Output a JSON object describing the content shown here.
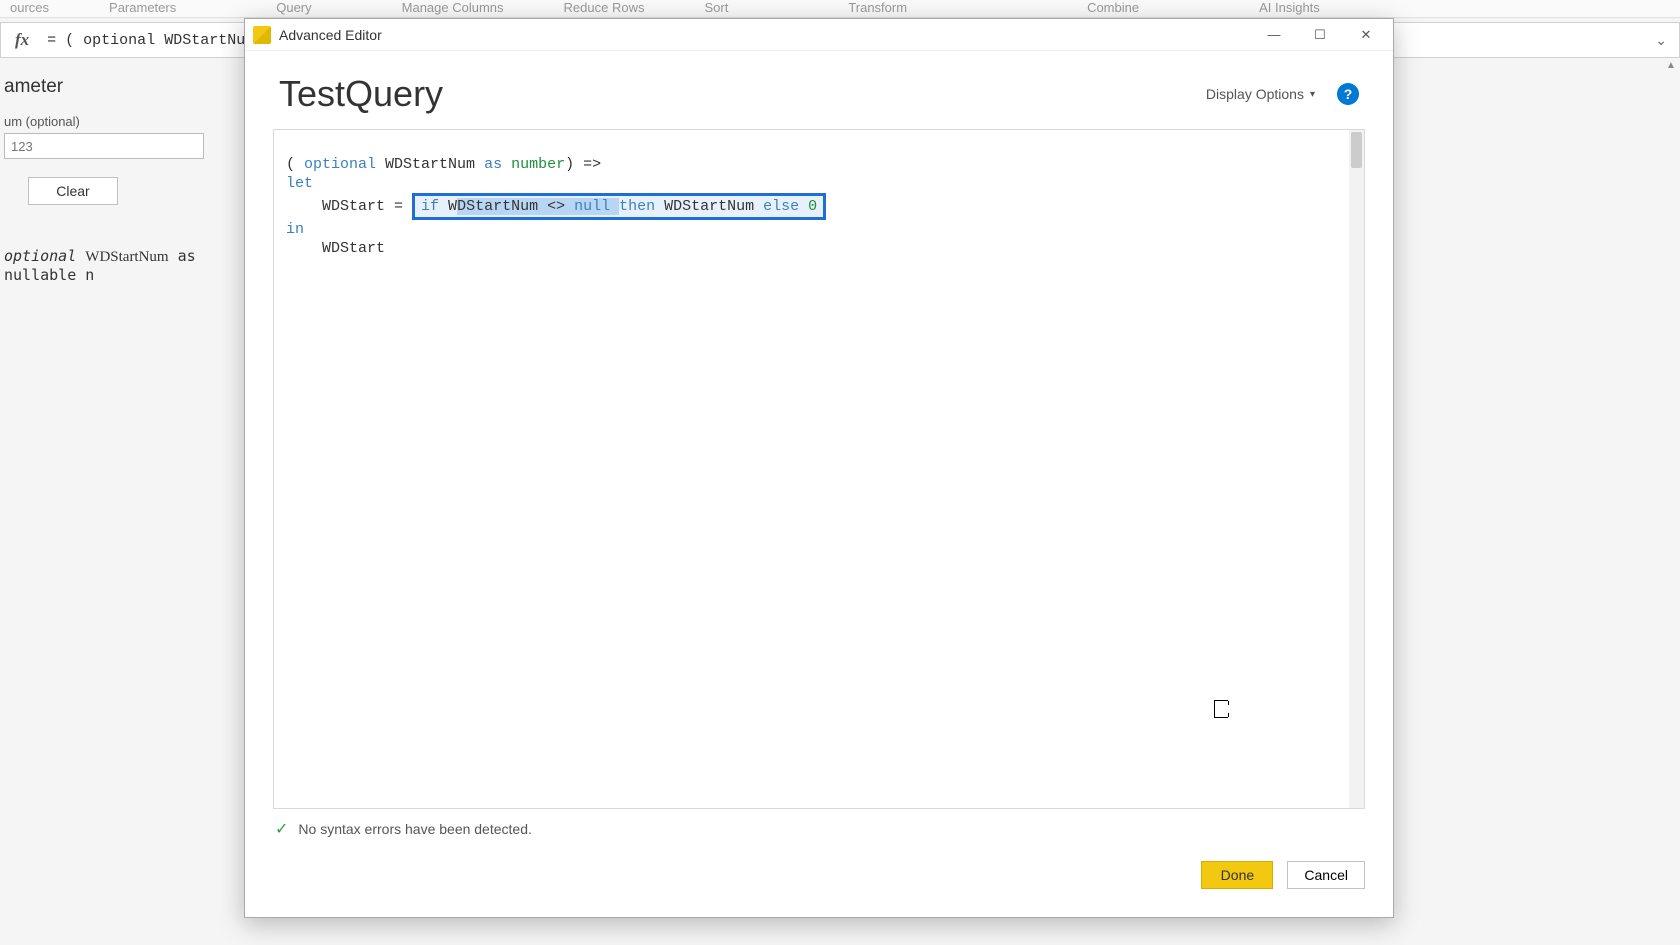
{
  "ribbon": {
    "items": [
      "ources",
      "Parameters",
      "Query",
      "Manage Columns",
      "Reduce Rows",
      "Sort",
      "Transform",
      "Combine",
      "AI Insights"
    ]
  },
  "formulaBar": {
    "fx": "fx",
    "text": "= ( optional WDStartNum a"
  },
  "bgPanel": {
    "heading": "ameter",
    "label": "um (optional)",
    "placeholder": "123",
    "clearBtn": "Clear",
    "codeLine": "optional WDStartNum as nullable n"
  },
  "dialog": {
    "title": "Advanced Editor",
    "queryName": "TestQuery",
    "displayOptions": "Display Options",
    "code": {
      "l1a": "( ",
      "l1b": "optional",
      "l1c": " WDStartNum ",
      "l1d": "as",
      "l1e": " ",
      "l1f": "number",
      "l1g": ") =>",
      "l2": "let",
      "l3a": "    WDStart = ",
      "hlIf": "if",
      "hlA": " W",
      "hlB": "DStartNum <> ",
      "hlNull": "null ",
      "hlThen": "then",
      "hlC": " WDStartNum ",
      "hlElse": "else",
      "hlZero": " 0",
      "l4": "in",
      "l5": "    WDStart"
    },
    "status": "No syntax errors have been detected.",
    "doneBtn": "Done",
    "cancelBtn": "Cancel"
  }
}
